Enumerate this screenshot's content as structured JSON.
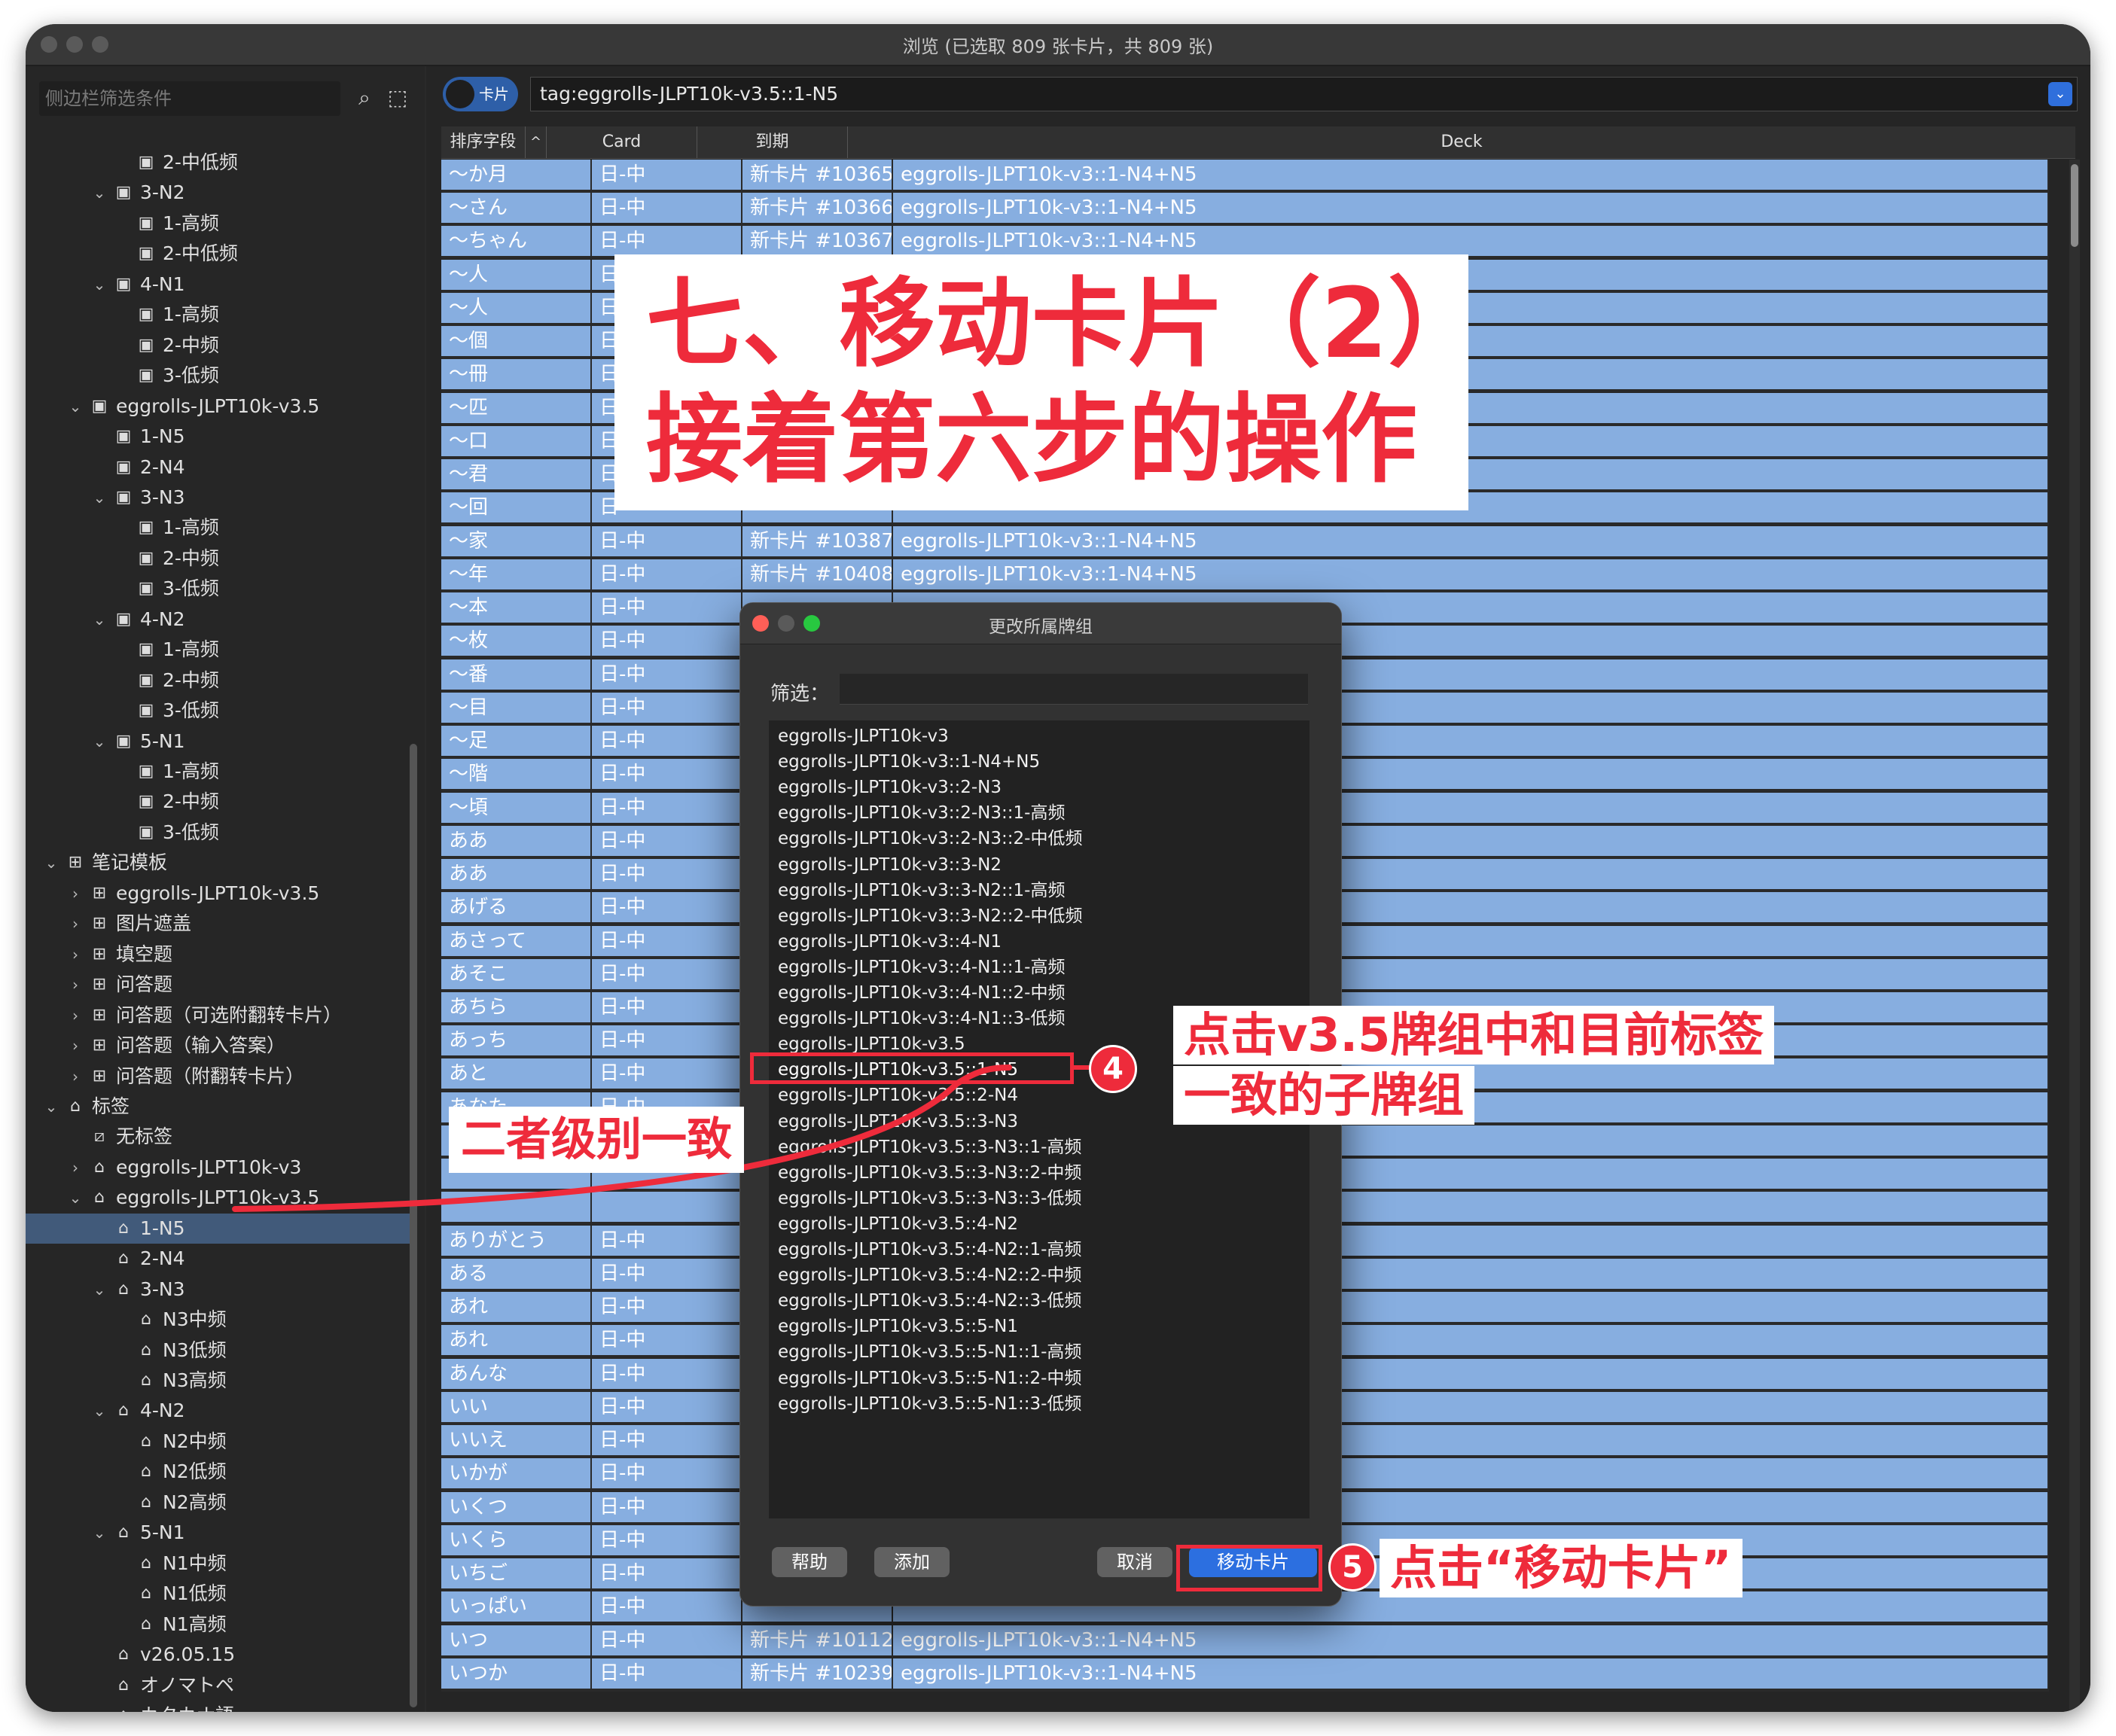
{
  "window": {
    "title": "浏览 (已选取 809 张卡片，共 809 张)"
  },
  "sidebar": {
    "search_placeholder": "侧边栏筛选条件",
    "search_icon": "search-icon",
    "select_icon": "marquee-select-icon",
    "tree": [
      {
        "label": "2-中低频",
        "level": 4,
        "icon": "deck",
        "arrow": ""
      },
      {
        "label": "3-N2",
        "level": 3,
        "icon": "deck",
        "arrow": "down"
      },
      {
        "label": "1-高频",
        "level": 4,
        "icon": "deck",
        "arrow": ""
      },
      {
        "label": "2-中低频",
        "level": 4,
        "icon": "deck",
        "arrow": ""
      },
      {
        "label": "4-N1",
        "level": 3,
        "icon": "deck",
        "arrow": "down"
      },
      {
        "label": "1-高频",
        "level": 4,
        "icon": "deck",
        "arrow": ""
      },
      {
        "label": "2-中频",
        "level": 4,
        "icon": "deck",
        "arrow": ""
      },
      {
        "label": "3-低频",
        "level": 4,
        "icon": "deck",
        "arrow": ""
      },
      {
        "label": "eggrolls-JLPT10k-v3.5",
        "level": 2,
        "icon": "deck",
        "arrow": "down"
      },
      {
        "label": "1-N5",
        "level": 3,
        "icon": "deck",
        "arrow": ""
      },
      {
        "label": "2-N4",
        "level": 3,
        "icon": "deck",
        "arrow": ""
      },
      {
        "label": "3-N3",
        "level": 3,
        "icon": "deck",
        "arrow": "down"
      },
      {
        "label": "1-高频",
        "level": 4,
        "icon": "deck",
        "arrow": ""
      },
      {
        "label": "2-中频",
        "level": 4,
        "icon": "deck",
        "arrow": ""
      },
      {
        "label": "3-低频",
        "level": 4,
        "icon": "deck",
        "arrow": ""
      },
      {
        "label": "4-N2",
        "level": 3,
        "icon": "deck",
        "arrow": "down"
      },
      {
        "label": "1-高频",
        "level": 4,
        "icon": "deck",
        "arrow": ""
      },
      {
        "label": "2-中频",
        "level": 4,
        "icon": "deck",
        "arrow": ""
      },
      {
        "label": "3-低频",
        "level": 4,
        "icon": "deck",
        "arrow": ""
      },
      {
        "label": "5-N1",
        "level": 3,
        "icon": "deck",
        "arrow": "down"
      },
      {
        "label": "1-高频",
        "level": 4,
        "icon": "deck",
        "arrow": ""
      },
      {
        "label": "2-中频",
        "level": 4,
        "icon": "deck",
        "arrow": ""
      },
      {
        "label": "3-低频",
        "level": 4,
        "icon": "deck",
        "arrow": ""
      },
      {
        "label": "笔记模板",
        "level": 1,
        "icon": "notetype",
        "arrow": "down"
      },
      {
        "label": "eggrolls-JLPT10k-v3.5",
        "level": 2,
        "icon": "notetype",
        "arrow": "right"
      },
      {
        "label": "图片遮盖",
        "level": 2,
        "icon": "notetype",
        "arrow": "right"
      },
      {
        "label": "填空题",
        "level": 2,
        "icon": "notetype",
        "arrow": "right"
      },
      {
        "label": "问答题",
        "level": 2,
        "icon": "notetype",
        "arrow": "right"
      },
      {
        "label": "问答题（可选附翻转卡片）",
        "level": 2,
        "icon": "notetype",
        "arrow": "right"
      },
      {
        "label": "问答题（输入答案）",
        "level": 2,
        "icon": "notetype",
        "arrow": "right"
      },
      {
        "label": "问答题（附翻转卡片）",
        "level": 2,
        "icon": "notetype",
        "arrow": "right"
      },
      {
        "label": "标签",
        "level": 1,
        "icon": "tag",
        "arrow": "down"
      },
      {
        "label": "无标签",
        "level": 2,
        "icon": "untagged",
        "arrow": ""
      },
      {
        "label": "eggrolls-JLPT10k-v3",
        "level": 2,
        "icon": "tag",
        "arrow": "right"
      },
      {
        "label": "eggrolls-JLPT10k-v3.5",
        "level": 2,
        "icon": "tag",
        "arrow": "down"
      },
      {
        "label": "1-N5",
        "level": 3,
        "icon": "tag",
        "arrow": "",
        "selected": true
      },
      {
        "label": "2-N4",
        "level": 3,
        "icon": "tag",
        "arrow": ""
      },
      {
        "label": "3-N3",
        "level": 3,
        "icon": "tag",
        "arrow": "down"
      },
      {
        "label": "N3中频",
        "level": 4,
        "icon": "tag",
        "arrow": ""
      },
      {
        "label": "N3低频",
        "level": 4,
        "icon": "tag",
        "arrow": ""
      },
      {
        "label": "N3高频",
        "level": 4,
        "icon": "tag",
        "arrow": ""
      },
      {
        "label": "4-N2",
        "level": 3,
        "icon": "tag",
        "arrow": "down"
      },
      {
        "label": "N2中频",
        "level": 4,
        "icon": "tag",
        "arrow": ""
      },
      {
        "label": "N2低频",
        "level": 4,
        "icon": "tag",
        "arrow": ""
      },
      {
        "label": "N2高频",
        "level": 4,
        "icon": "tag",
        "arrow": ""
      },
      {
        "label": "5-N1",
        "level": 3,
        "icon": "tag",
        "arrow": "down"
      },
      {
        "label": "N1中频",
        "level": 4,
        "icon": "tag",
        "arrow": ""
      },
      {
        "label": "N1低频",
        "level": 4,
        "icon": "tag",
        "arrow": ""
      },
      {
        "label": "N1高频",
        "level": 4,
        "icon": "tag",
        "arrow": ""
      },
      {
        "label": "v26.05.15",
        "level": 3,
        "icon": "tag",
        "arrow": ""
      },
      {
        "label": "オノマトペ",
        "level": 3,
        "icon": "tag",
        "arrow": ""
      },
      {
        "label": "カタカナ語",
        "level": 3,
        "icon": "tag",
        "arrow": ""
      }
    ]
  },
  "toolbar": {
    "toggle_label": "卡片",
    "query": "tag:eggrolls-JLPT10k-v3.5::1-N5",
    "dropdown_icon": "chevron-down-icon"
  },
  "table": {
    "columns": [
      "排序字段",
      "Card",
      "到期",
      "Deck"
    ],
    "sort_indicator": "^",
    "rows": [
      [
        "〜か月",
        "日-中",
        "新卡片 #10365",
        "eggrolls-JLPT10k-v3::1-N4+N5"
      ],
      [
        "〜さん",
        "日-中",
        "新卡片 #10366",
        "eggrolls-JLPT10k-v3::1-N4+N5"
      ],
      [
        "〜ちゃん",
        "日-中",
        "新卡片 #10367",
        "eggrolls-JLPT10k-v3::1-N4+N5"
      ],
      [
        "〜人",
        "日",
        "",
        ""
      ],
      [
        "〜人",
        "日",
        "",
        ""
      ],
      [
        "〜個",
        "日",
        "",
        ""
      ],
      [
        "〜冊",
        "日",
        "",
        ""
      ],
      [
        "〜匹",
        "日",
        "",
        ""
      ],
      [
        "〜口",
        "日",
        "",
        ""
      ],
      [
        "〜君",
        "日",
        "",
        ""
      ],
      [
        "〜回",
        "日",
        "",
        ""
      ],
      [
        "〜家",
        "日-中",
        "新卡片 #10387",
        "eggrolls-JLPT10k-v3::1-N4+N5"
      ],
      [
        "〜年",
        "日-中",
        "新卡片 #10408",
        "eggrolls-JLPT10k-v3::1-N4+N5"
      ],
      [
        "〜本",
        "日-中",
        "",
        ""
      ],
      [
        "〜枚",
        "日-中",
        "",
        ""
      ],
      [
        "〜番",
        "日-中",
        "",
        ""
      ],
      [
        "〜目",
        "日-中",
        "",
        ""
      ],
      [
        "〜足",
        "日-中",
        "",
        ""
      ],
      [
        "〜階",
        "日-中",
        "",
        ""
      ],
      [
        "〜頃",
        "日-中",
        "",
        ""
      ],
      [
        "ああ",
        "日-中",
        "",
        ""
      ],
      [
        "ああ",
        "日-中",
        "",
        ""
      ],
      [
        "あげる",
        "日-中",
        "",
        ""
      ],
      [
        "あさって",
        "日-中",
        "",
        ""
      ],
      [
        "あそこ",
        "日-中",
        "",
        ""
      ],
      [
        "あちら",
        "日-中",
        "",
        ""
      ],
      [
        "あっち",
        "日-中",
        "",
        ""
      ],
      [
        "あと",
        "日-中",
        "",
        ""
      ],
      [
        "あなた",
        "日-中",
        "",
        ""
      ],
      [
        "",
        "",
        "",
        ""
      ],
      [
        "",
        "",
        "",
        ""
      ],
      [
        "",
        "",
        "",
        ""
      ],
      [
        "ありがとう",
        "日-中",
        "",
        ""
      ],
      [
        "ある",
        "日-中",
        "",
        ""
      ],
      [
        "あれ",
        "日-中",
        "",
        ""
      ],
      [
        "あれ",
        "日-中",
        "",
        ""
      ],
      [
        "あんな",
        "日-中",
        "",
        ""
      ],
      [
        "いい",
        "日-中",
        "",
        ""
      ],
      [
        "いいえ",
        "日-中",
        "",
        ""
      ],
      [
        "いかが",
        "日-中",
        "",
        ""
      ],
      [
        "いくつ",
        "日-中",
        "",
        ""
      ],
      [
        "いくら",
        "日-中",
        "",
        ""
      ],
      [
        "いちご",
        "日-中",
        "",
        ""
      ],
      [
        "いっぱい",
        "日-中",
        "",
        ""
      ],
      [
        "いつ",
        "日-中",
        "新卡片 #10112",
        "eggrolls-JLPT10k-v3::1-N4+N5"
      ],
      [
        "いつか",
        "日-中",
        "新卡片 #10239",
        "eggrolls-JLPT10k-v3::1-N4+N5"
      ]
    ]
  },
  "banner": {
    "line1": "七、移动卡片（2）",
    "line2": "接着第六步的操作"
  },
  "dialog": {
    "title": "更改所属牌组",
    "filter_label": "筛选：",
    "filter_value": "",
    "decks": [
      "eggrolls-JLPT10k-v3",
      "eggrolls-JLPT10k-v3::1-N4+N5",
      "eggrolls-JLPT10k-v3::2-N3",
      "eggrolls-JLPT10k-v3::2-N3::1-高频",
      "eggrolls-JLPT10k-v3::2-N3::2-中低频",
      "eggrolls-JLPT10k-v3::3-N2",
      "eggrolls-JLPT10k-v3::3-N2::1-高频",
      "eggrolls-JLPT10k-v3::3-N2::2-中低频",
      "eggrolls-JLPT10k-v3::4-N1",
      "eggrolls-JLPT10k-v3::4-N1::1-高频",
      "eggrolls-JLPT10k-v3::4-N1::2-中频",
      "eggrolls-JLPT10k-v3::4-N1::3-低频",
      "eggrolls-JLPT10k-v3.5",
      "eggrolls-JLPT10k-v3.5::1-N5",
      "eggrolls-JLPT10k-v3.5::2-N4",
      "eggrolls-JLPT10k-v3.5::3-N3",
      "eggrolls-JLPT10k-v3.5::3-N3::1-高频",
      "eggrolls-JLPT10k-v3.5::3-N3::2-中频",
      "eggrolls-JLPT10k-v3.5::3-N3::3-低频",
      "eggrolls-JLPT10k-v3.5::4-N2",
      "eggrolls-JLPT10k-v3.5::4-N2::1-高频",
      "eggrolls-JLPT10k-v3.5::4-N2::2-中频",
      "eggrolls-JLPT10k-v3.5::4-N2::3-低频",
      "eggrolls-JLPT10k-v3.5::5-N1",
      "eggrolls-JLPT10k-v3.5::5-N1::1-高频",
      "eggrolls-JLPT10k-v3.5::5-N1::2-中频",
      "eggrolls-JLPT10k-v3.5::5-N1::3-低频"
    ],
    "selected_deck": "eggrolls-JLPT10k-v3.5::1-N5",
    "help_label": "帮助",
    "add_label": "添加",
    "cancel_label": "取消",
    "move_label": "移动卡片"
  },
  "annotations": {
    "step4": "4",
    "step5": "5",
    "note_same_level": "二者级别一致",
    "note_step4_line1": "点击v3.5牌组中和目前标签",
    "note_step4_line2": "一致的子牌组",
    "note_step5": "点击“移动卡片”"
  },
  "colors": {
    "accent_red": "#ee2b3b",
    "row_selected": "#87aee0",
    "primary_button": "#2c6fe0"
  }
}
